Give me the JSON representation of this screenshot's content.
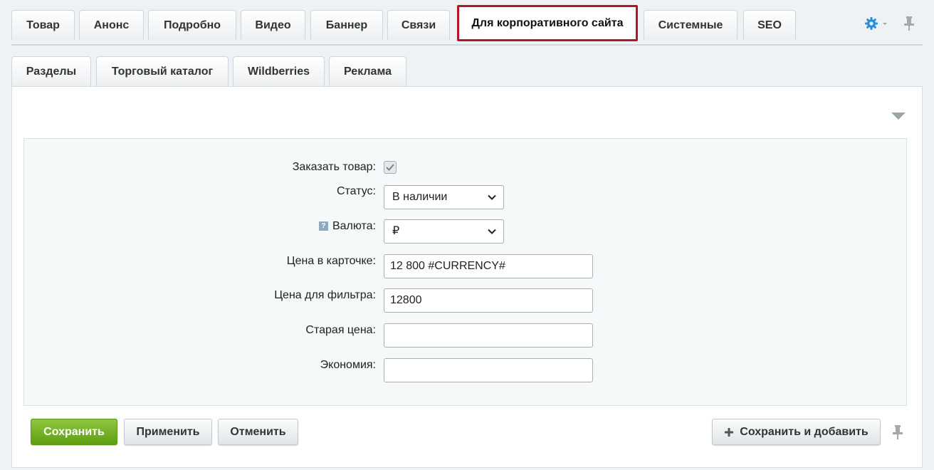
{
  "top_tabs": [
    {
      "label": "Товар"
    },
    {
      "label": "Анонс"
    },
    {
      "label": "Подробно"
    },
    {
      "label": "Видео"
    },
    {
      "label": "Баннер"
    },
    {
      "label": "Связи"
    },
    {
      "label": "Для корпоративного сайта",
      "active": true
    },
    {
      "label": "Системные"
    },
    {
      "label": "SEO"
    }
  ],
  "sub_tabs": [
    {
      "label": "Разделы"
    },
    {
      "label": "Торговый каталог"
    },
    {
      "label": "Wildberries"
    },
    {
      "label": "Реклама"
    }
  ],
  "form": {
    "order_label": "Заказать товар:",
    "order_checked": true,
    "status_label": "Статус:",
    "status_value": "В наличии",
    "currency_help": "?",
    "currency_label": "Валюта:",
    "currency_value": "₽",
    "card_price_label": "Цена в карточке:",
    "card_price_value": "12 800 #CURRENCY#",
    "filter_price_label": "Цена для фильтра:",
    "filter_price_value": "12800",
    "old_price_label": "Старая цена:",
    "old_price_value": "",
    "savings_label": "Экономия:",
    "savings_value": ""
  },
  "buttons": {
    "save": "Сохранить",
    "apply": "Применить",
    "cancel": "Отменить",
    "save_add": "Сохранить и добавить"
  },
  "colors": {
    "accent_green": "#6aae1c",
    "highlight_red": "#b01923",
    "gear_blue": "#2b8fd8"
  }
}
